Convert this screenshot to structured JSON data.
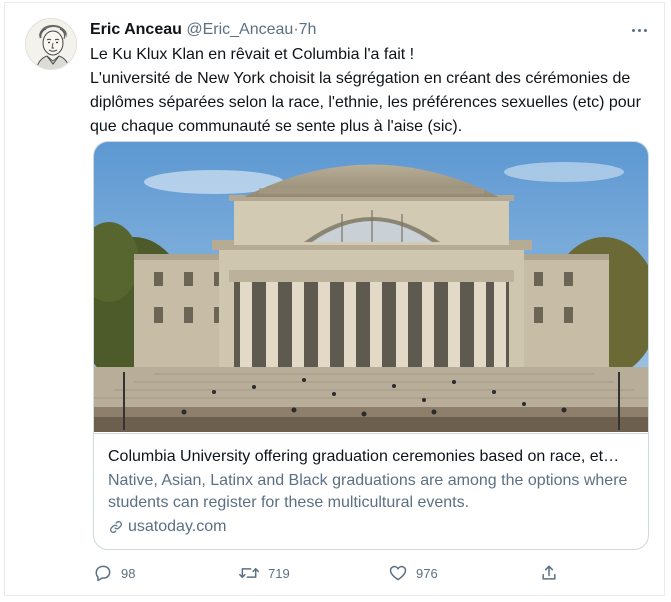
{
  "author": {
    "name": "Eric Anceau",
    "handle": "@Eric_Anceau",
    "separator": "·",
    "time": "7h"
  },
  "tweet": {
    "lines": [
      "Le Ku Klux Klan en rêvait et Columbia l'a fait !",
      "L'université de New York choisit la ségrégation en créant des cérémonies de diplômes séparées selon la race, l'ethnie, les préférences sexuelles (etc) pour que chaque communauté se sente plus à l'aise (sic)."
    ]
  },
  "card": {
    "title": "Columbia University offering graduation ceremonies based on race, et…",
    "description": "Native, Asian, Latinx and Black graduations are among the options where students can register for these multicultural events.",
    "domain": "usatoday.com",
    "domain_icon": "link-icon"
  },
  "actions": {
    "reply_count": "98",
    "retweet_count": "719",
    "like_count": "976"
  },
  "colors": {
    "secondary_text": "#5b7083",
    "border": "#cfd9de",
    "sky": "#6aa3d8"
  }
}
